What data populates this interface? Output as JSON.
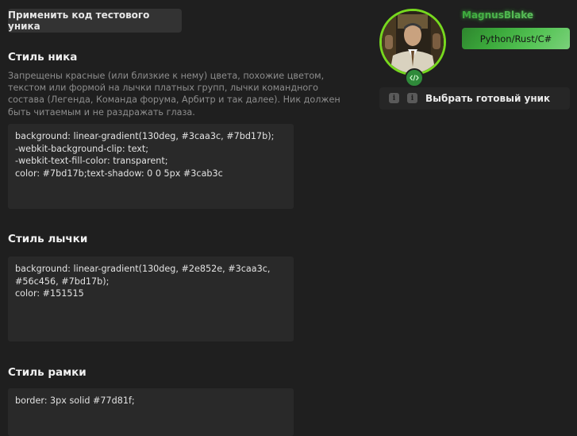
{
  "buttons": {
    "apply_test_code": "Применить код тестового уника"
  },
  "nick_style": {
    "title": "Стиль ника",
    "description": "Запрещены красные (или близкие к нему) цвета, похожие цветом, текстом или формой на лычки платных групп, лычки командного состава (Легенда, Команда форума, Арбитр и так далее). Ник должен быть читаемым и не раздражать глаза.",
    "code": "background: linear-gradient(130deg, #3caa3c, #7bd17b);\n-webkit-background-clip: text;\n-webkit-text-fill-color: transparent;\ncolor: #7bd17b;text-shadow: 0 0 5px #3cab3c"
  },
  "badge_style": {
    "title": "Стиль лычки",
    "code": "background: linear-gradient(130deg, #2e852e, #3caa3c,\n#56c456, #7bd17b);\ncolor: #151515"
  },
  "frame_style": {
    "title": "Стиль рамки",
    "code": "border: 3px solid #77d81f;"
  },
  "preview": {
    "username": "MagnusBlake",
    "title_badge": "Python/Rust/C#",
    "avatar_icon": "user-avatar-photo",
    "badge_icon": "code-icon",
    "frame_color": "#77d81f"
  },
  "preset": {
    "label": "Выбрать готовый уник",
    "icons": [
      "info-icon",
      "info-icon"
    ]
  },
  "colors": {
    "background": "#1f1f1f",
    "panel": "#292929",
    "accent": "#3caa3c",
    "frame": "#77d81f"
  }
}
